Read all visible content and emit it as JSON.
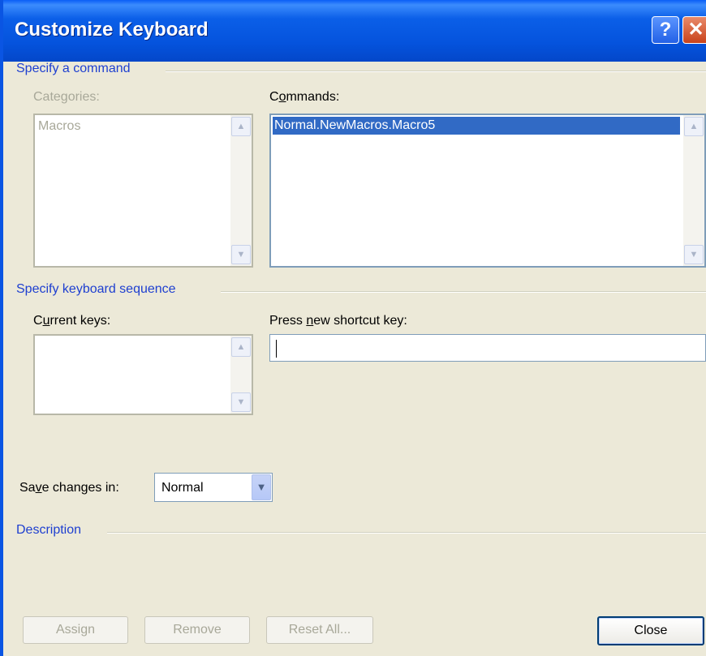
{
  "window": {
    "title": "Customize Keyboard",
    "help_glyph": "?",
    "close_glyph": "✕"
  },
  "specify_command": {
    "heading": "Specify a command",
    "categories_label": "Categories:",
    "categories_items": [
      "Macros"
    ],
    "commands_label_pre": "C",
    "commands_label_mnemonic": "o",
    "commands_label_post": "mmands:",
    "commands_items": [
      "Normal.NewMacros.Macro5"
    ]
  },
  "keyboard_sequence": {
    "heading": "Specify keyboard sequence",
    "current_keys_label_pre": "C",
    "current_keys_label_mnemonic": "u",
    "current_keys_label_post": "rrent keys:",
    "press_new_label_pre": "Press ",
    "press_new_label_mnemonic": "n",
    "press_new_label_post": "ew shortcut key:",
    "press_new_value": ""
  },
  "save_changes": {
    "label_pre": "Sa",
    "label_mnemonic": "v",
    "label_post": "e changes in:",
    "value": "Normal"
  },
  "description": {
    "heading": "Description"
  },
  "buttons": {
    "assign": "Assign",
    "remove": "Remove",
    "reset_all": "Reset All...",
    "close": "Close"
  },
  "icons": {
    "scroll_up": "▲",
    "scroll_down": "▼",
    "dropdown": "▼"
  }
}
